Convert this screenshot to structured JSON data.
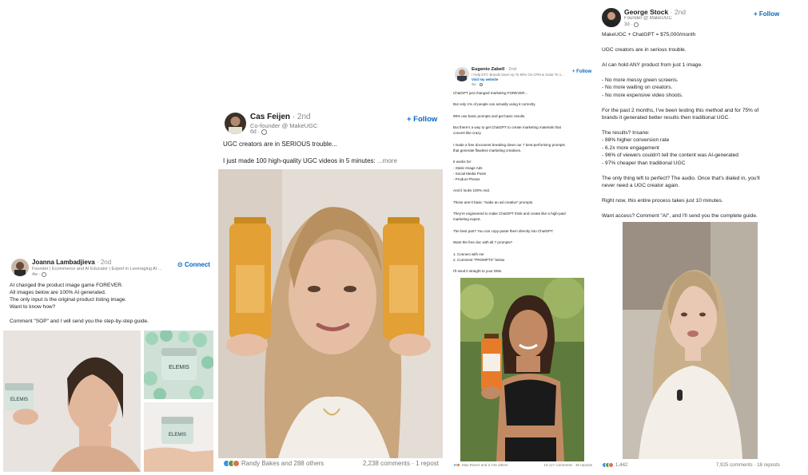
{
  "posts": [
    {
      "author": "Joanna Lambadjieva",
      "degree": "· 2nd",
      "headline": "Founder | Ecommerce and AI Educator | Expert in Leveraging AI ...",
      "time": "4w ·",
      "action": "Connect",
      "body": [
        "AI changed the product image game FOREVER.",
        "All images below are 100% AI generated.",
        "The only input is the original product listing image.",
        "Want to know how?",
        "",
        "Comment \"SOP\" and I will send you the step-by-step guide."
      ]
    },
    {
      "author": "Cas Feijen",
      "degree": "· 2nd",
      "headline": "Co-founder @ MakeUGC",
      "time": "6d ·",
      "action": "+ Follow",
      "body": [
        "UGC creators are in SERIOUS trouble...",
        "",
        "I just made 100 high-quality UGC videos in 5 minutes:"
      ],
      "more": "...more",
      "reactions_text": "Randy Bakes and 288 others",
      "comments_text": "2,238 comments · 1 repost"
    },
    {
      "author": "Eugenio Zabell",
      "degree": "· 2nd",
      "headline": "I Help DTC Brands Save Up To 80% On CPM & Scale To 1...",
      "visit": "Visit my website",
      "time": "3w ·",
      "action": "+ Follow",
      "body": [
        "ChatGPT just changed marketing FOREVER...",
        "",
        "But only 1% of people can actually using it correctly.",
        "",
        "99% use basic prompts and get basic results.",
        "",
        "But there's a way to get ChatGPT to create marketing materials that",
        "convert like crazy.",
        "",
        "I made a free document breaking down our 7 best-performing prompts",
        "that generate flawless marketing creatives.",
        "",
        "It works for:",
        "- Static Image Ads",
        "- Social Media Posts",
        "- Product Photos",
        "",
        "And it looks 100% real.",
        "",
        "These aren't basic \"make an ad creative\" prompts.",
        "",
        "They're engineered to make ChatGPT think and create like a high-paid",
        "marketing expert.",
        "",
        "The best part? You can copy-paste them directly into ChatGPT.",
        "",
        "Want the free doc with all 7 prompts?",
        "",
        "1. Connect with me",
        "2. Comment \"PROMPTS\" below",
        "",
        "I'll send it straight to your DMs."
      ],
      "reactions_text": "Max Rivers and 3,716 others",
      "comments_text": "10,117 comments · 35 reposts"
    },
    {
      "author": "George Stock",
      "degree": "· 2nd",
      "headline": "Founder @ MakeUGC",
      "time": "3d ·",
      "action": "+ Follow",
      "body": [
        "MakeUGC + ChatGPT = $75,000/month",
        "",
        "UGC creators are in serious trouble.",
        "",
        "AI can hold ANY product from just 1 image.",
        "",
        "- No more messy green screens.",
        "- No more waiting on creators.",
        "- No more expensive video shoots.",
        "",
        "For the past 2 months, I've been testing this method and for 75% of",
        "brands it generated better results then traditional UGC.",
        "",
        "The results? Insane:",
        "- 88% higher conversion rate",
        "- 6.2x more engagement",
        "- 96% of viewers couldn't tell the content was AI-generated",
        "- 97% cheaper than traditional UGC",
        "",
        "The only thing left to perfect? The audio. Once that's dialed in, you'll",
        "never need a UGC creator again.",
        "",
        "Right now, this entire process takes just 10 minutes.",
        "",
        "Want access? Comment \"AI\", and I'll send you the complete guide."
      ],
      "reactions_text": "1,442",
      "comments_text": "7,925 comments · 18 reposts"
    }
  ],
  "image_labels": {
    "elemis": "ELEMIS"
  },
  "colors": {
    "link_blue": "#0a66c2",
    "like": "#378fe9",
    "celebrate": "#5f9b41",
    "love": "#df704d"
  }
}
